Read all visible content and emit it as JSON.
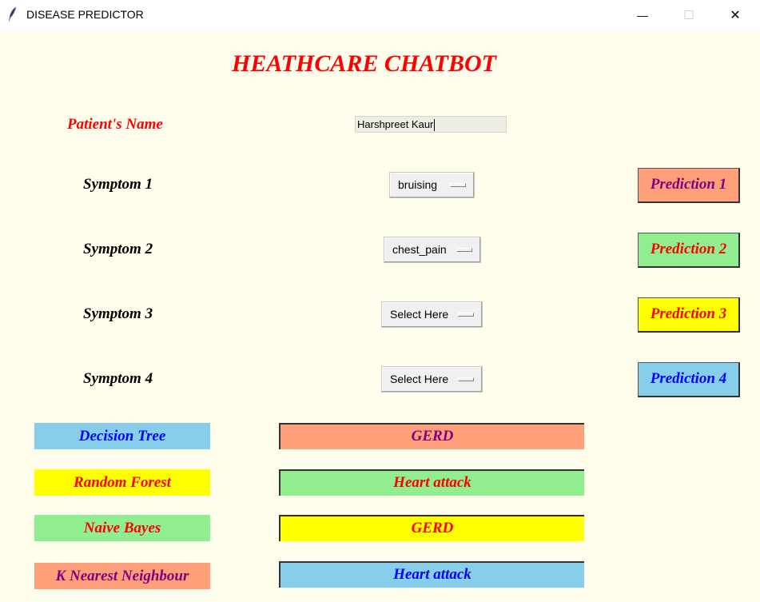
{
  "window": {
    "title": "DISEASE PREDICTOR",
    "minimize_glyph": "—",
    "maximize_glyph": "☐",
    "close_glyph": "✕"
  },
  "header": {
    "title": "HEATHCARE CHATBOT"
  },
  "patient": {
    "label": "Patient's Name",
    "value": "Harshpreet Kaur"
  },
  "symptoms": [
    {
      "label": "Symptom 1",
      "value": "bruising"
    },
    {
      "label": "Symptom 2",
      "value": "chest_pain"
    },
    {
      "label": "Symptom 3",
      "value": "Select Here"
    },
    {
      "label": "Symptom 4",
      "value": "Select Here"
    }
  ],
  "predictions": [
    {
      "label": "Prediction 1",
      "bg": "#FFA07A",
      "fg": "#800080"
    },
    {
      "label": "Prediction 2",
      "bg": "#90EE90",
      "fg": "#FF0000"
    },
    {
      "label": "Prediction 3",
      "bg": "#FFFF00",
      "fg": "#FF0000"
    },
    {
      "label": "Prediction 4",
      "bg": "#87CEEB",
      "fg": "#0000FF"
    }
  ],
  "algorithms": [
    {
      "label": "Decision Tree",
      "result": "GERD",
      "label_bg": "#87CEEB",
      "label_fg": "#0000FF",
      "result_bg": "#FFA07A",
      "result_fg": "#800080"
    },
    {
      "label": "Random Forest",
      "result": "Heart attack",
      "label_bg": "#FFFF00",
      "label_fg": "#FF0000",
      "result_bg": "#90EE90",
      "result_fg": "#FF0000"
    },
    {
      "label": "Naive Bayes",
      "result": "GERD",
      "label_bg": "#90EE90",
      "label_fg": "#FF0000",
      "result_bg": "#FFFF00",
      "result_fg": "#FF0000"
    },
    {
      "label": "K Nearest Neighbour",
      "result": "Heart attack",
      "label_bg": "#FFA07A",
      "label_fg": "#800080",
      "result_bg": "#87CEEB",
      "result_fg": "#0000FF"
    }
  ]
}
